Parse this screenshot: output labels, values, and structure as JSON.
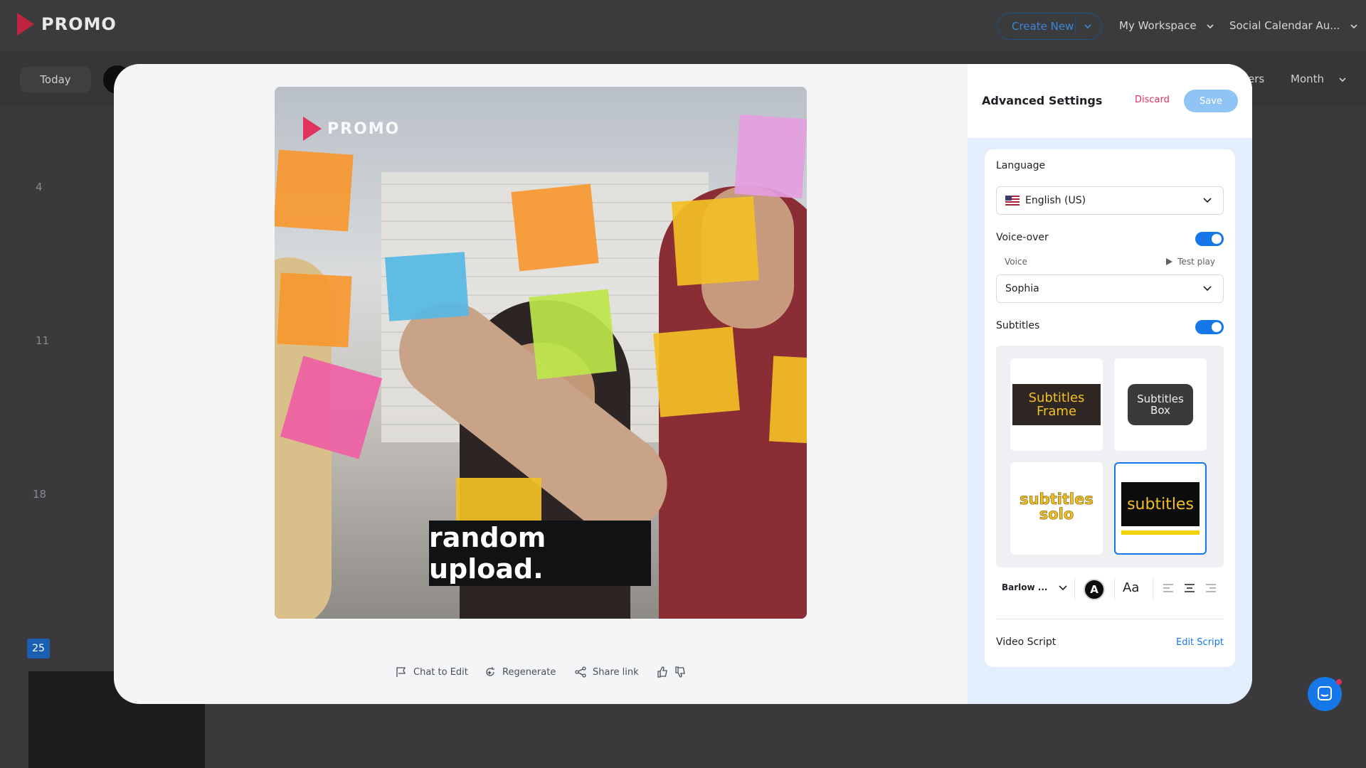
{
  "app": {
    "brand": "PROMO"
  },
  "header": {
    "create_new": "Create New",
    "workspace": "My Workspace",
    "calendar": "Social Calendar Au..."
  },
  "toolbar": {
    "today": "Today",
    "filters_partial": "ers",
    "view": "Month"
  },
  "calendar": {
    "day_numbers": [
      "4",
      "11",
      "18"
    ],
    "highlight_day": "25"
  },
  "video": {
    "watermark": "PROMO",
    "caption": "random upload."
  },
  "actions": {
    "chat": "Chat to Edit",
    "regenerate": "Regenerate",
    "share": "Share link"
  },
  "panel": {
    "title": "Advanced Settings",
    "discard": "Discard",
    "save": "Save",
    "language_label": "Language",
    "language_value": "English (US)",
    "voiceover_label": "Voice-over",
    "voiceover_on": true,
    "voice_label": "Voice",
    "test_play": "Test play",
    "voice_value": "Sophia",
    "subtitles_label": "Subtitles",
    "subtitles_on": true,
    "subtitle_styles": [
      {
        "line1": "Subtitles",
        "line2": "Frame",
        "selected": false
      },
      {
        "line1": "Subtitles",
        "line2": "Box",
        "selected": false
      },
      {
        "line1": "subtitles",
        "line2": "solo",
        "selected": false
      },
      {
        "line1": "subtitles",
        "line2": "",
        "selected": true
      }
    ],
    "font_value": "Barlow ...",
    "color_glyph": "A",
    "case_glyph": "Aa",
    "video_script_label": "Video Script",
    "edit_script": "Edit Script"
  },
  "colors": {
    "accent": "#1677e8",
    "danger": "#e0305a",
    "brand": "#c0243f"
  }
}
